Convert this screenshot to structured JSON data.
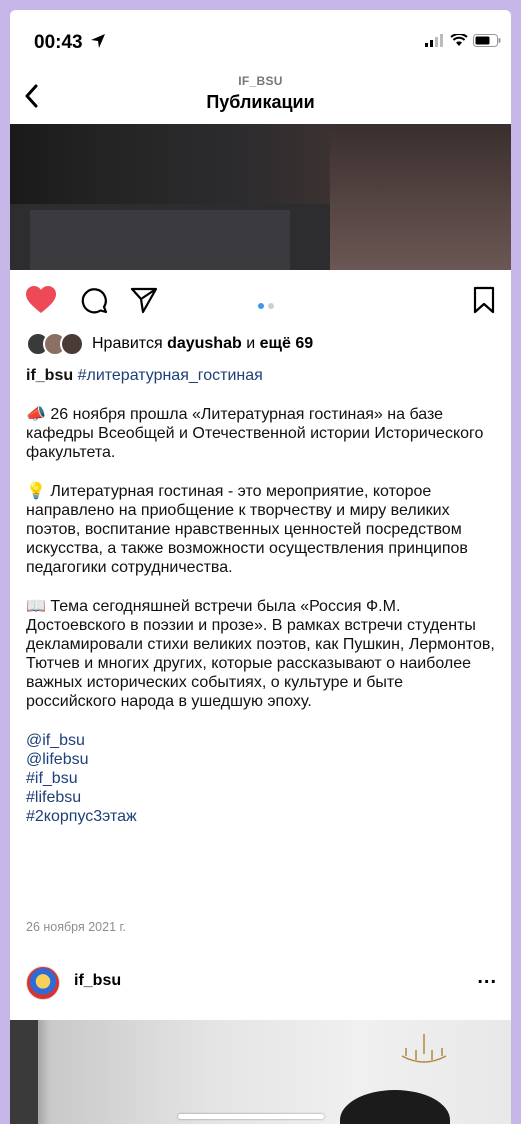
{
  "status_bar": {
    "time": "00:43"
  },
  "header": {
    "account": "IF_BSU",
    "title": "Публикации"
  },
  "likes": {
    "prefix": "Нравится",
    "user": "dayushab",
    "and": "и",
    "count": "ещё 69"
  },
  "caption": {
    "author": "if_bsu",
    "hashtag": "#литературная_гостиная",
    "para1_emoji": "📣",
    "para1": "26 ноября прошла «Литературная гостиная» на базе кафедры Всеобщей и Отечественной истории Исторического факультета.",
    "para2_emoji": "💡",
    "para2": "Литературная гостиная - это мероприятие, которое направлено на приобщение к творчеству и миру великих поэтов, воспитание нравственных ценностей посредством искусства, а также возможности осуществления принципов педагогики сотрудничества.",
    "para3_emoji": "📖",
    "para3": "Тема сегодняшней встречи была «Россия Ф.М. Достоевского в поэзии и прозе». В рамках встречи студенты декламировали стихи великих поэтов, как Пушкин, Лермонтов, Тютчев и многих других, которые рассказывают о наиболее важных исторических событиях, о культуре и быте российского народа в ушедшую эпоху.",
    "tags": [
      "@if_bsu",
      "@lifebsu",
      "#if_bsu",
      "#lifebsu",
      "#2корпус3этаж"
    ]
  },
  "date": "26 ноября 2021 г.",
  "next_post": {
    "username": "if_bsu",
    "more": "..."
  },
  "carousel": {
    "current": 1,
    "total": 2
  },
  "colors": {
    "heart": "#ed4956",
    "tag": "#1e3f78",
    "background": "#c7b6e8"
  },
  "icons": [
    "location-arrow-icon",
    "signal-icon",
    "wifi-icon",
    "battery-icon",
    "back-chevron-icon",
    "heart-icon",
    "comment-icon",
    "share-icon",
    "bookmark-icon",
    "more-icon"
  ]
}
